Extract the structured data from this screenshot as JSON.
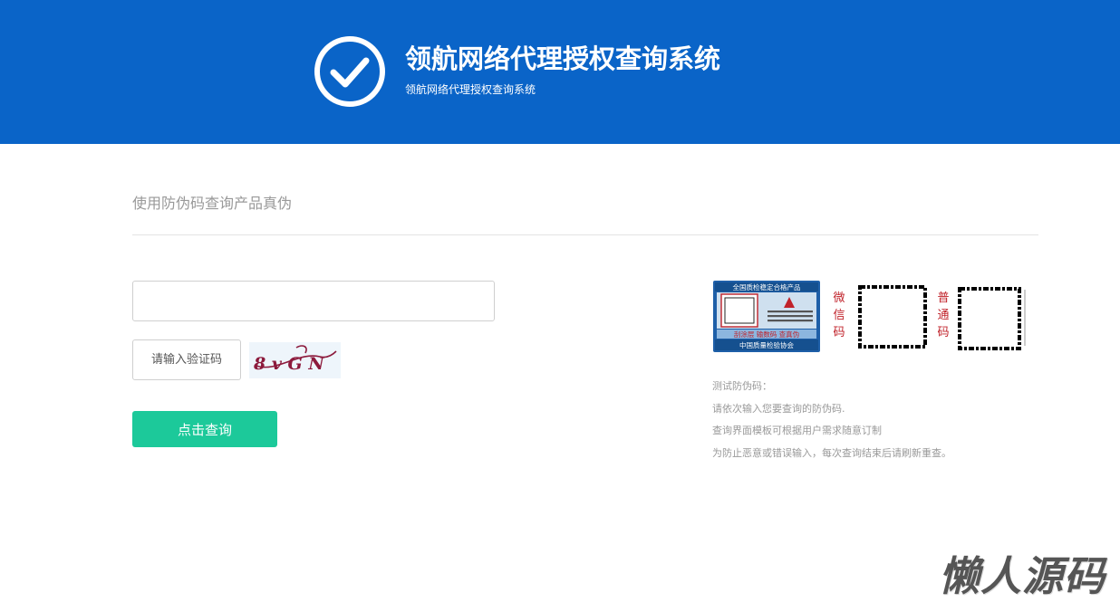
{
  "header": {
    "title": "领航网络代理授权查询系统",
    "subtitle": "领航网络代理授权查询系统",
    "logo_icon": "check-circle-icon",
    "bg_color": "#0a64c8"
  },
  "query": {
    "section_title": "使用防伪码查询产品真伪",
    "code_value": "",
    "captcha_placeholder": "请输入验证码",
    "captcha_text": "8 v G N",
    "submit_label": "点击查询",
    "submit_color": "#1cc99a"
  },
  "sample": {
    "label_header": "全国质检稳定合格产品",
    "label_scratch": "刮涂层  输数码  查真伪",
    "label_footer": "中国质量检验协会",
    "wechat_label": [
      "微",
      "信",
      "码"
    ],
    "normal_label": [
      "普",
      "通",
      "码"
    ]
  },
  "info": {
    "lines": [
      "测试防伪码：",
      "请依次输入您要查询的防伪码.",
      "查询界面模板可根据用户需求随意订制",
      "为防止恶意或错误输入，每次查询结束后请刷新重查。"
    ]
  },
  "watermark": "懒人源码"
}
